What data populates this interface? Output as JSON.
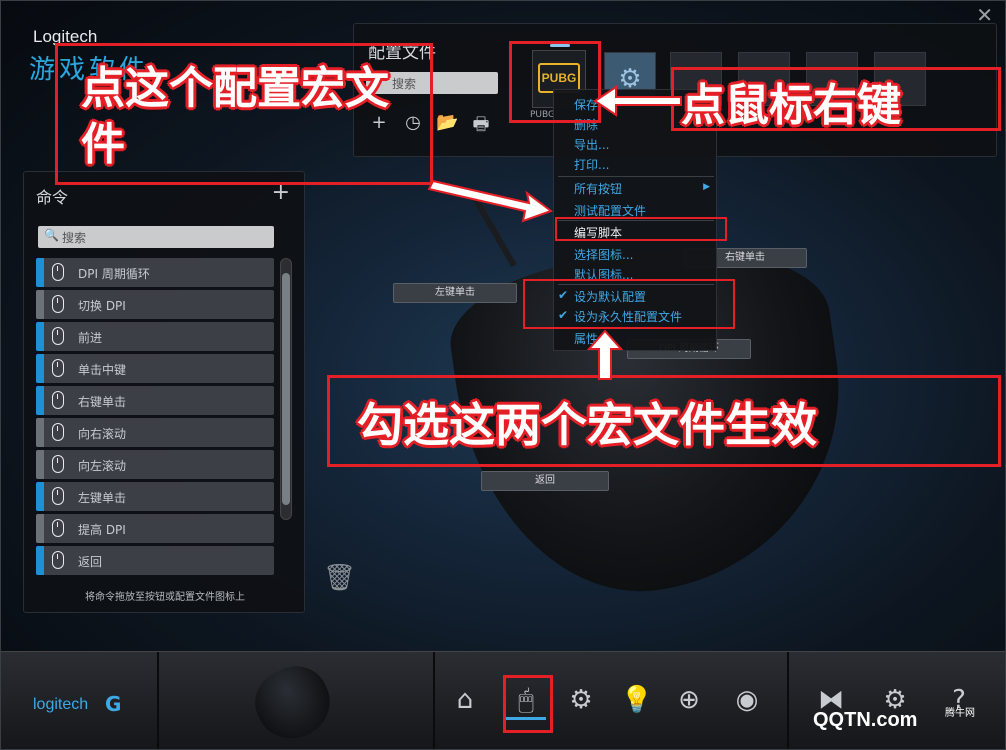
{
  "window": {
    "brand": "Logitech",
    "brand_sub": "游戏软件",
    "close_glyph": "✕"
  },
  "profile": {
    "title": "配置文件",
    "search_placeholder": "搜索",
    "active_profile_logo": "PUBG",
    "active_profile_label": "PUBG",
    "tools": [
      "+",
      "◷",
      "📂",
      "🖶"
    ]
  },
  "commands": {
    "title": "命令",
    "add": "+",
    "search_placeholder": "搜索",
    "items": [
      {
        "label": "DPI 周期循环",
        "accent": "blue"
      },
      {
        "label": "切换 DPI",
        "accent": "grey"
      },
      {
        "label": "前进",
        "accent": "blue"
      },
      {
        "label": "单击中键",
        "accent": "blue"
      },
      {
        "label": "右键单击",
        "accent": "blue"
      },
      {
        "label": "向右滚动",
        "accent": "grey"
      },
      {
        "label": "向左滚动",
        "accent": "grey"
      },
      {
        "label": "左键单击",
        "accent": "blue"
      },
      {
        "label": "提高 DPI",
        "accent": "grey"
      },
      {
        "label": "返回",
        "accent": "blue"
      }
    ],
    "hint": "将命令拖放至按钮或配置文件图标上"
  },
  "mouse_buttons": {
    "left_click": "左键单击",
    "right_click": "右键单击",
    "dpi_cycle": "DPI 周期循环",
    "back": "返回"
  },
  "context_menu": {
    "items": [
      {
        "label": "保存"
      },
      {
        "label": "删除"
      },
      {
        "label": "导出..."
      },
      {
        "label": "打印..."
      },
      {
        "label": "所有按钮",
        "submenu": true
      },
      {
        "label": "测试配置文件"
      },
      {
        "label": "编写脚本",
        "highlight": true
      },
      {
        "label": "选择图标..."
      },
      {
        "label": "默认图标..."
      },
      {
        "label": "设为默认配置",
        "checked": true
      },
      {
        "label": "设为永久性配置文件",
        "checked": true
      },
      {
        "label": "属性"
      }
    ]
  },
  "annotations": {
    "click_profile": "点这个配置宏文件",
    "right_click": "点鼠标右键",
    "check_both": "勾选这两个宏文件生效"
  },
  "bottom_bar": {
    "logo": "logitech",
    "logo_mark": "G",
    "icons": [
      "home-icon",
      "customize-buttons-icon",
      "pointer-settings-icon",
      "lighting-icon",
      "surface-tuning-icon",
      "heatmap-icon"
    ],
    "right_icons": [
      "share-icon",
      "settings-icon",
      "help-icon"
    ]
  },
  "watermark": {
    "text": "QQTN.com",
    "sub": "腾牛网"
  },
  "colors": {
    "accent": "#3fa9e6",
    "annotation": "#e51f26",
    "command_blue": "#1e90d6"
  }
}
